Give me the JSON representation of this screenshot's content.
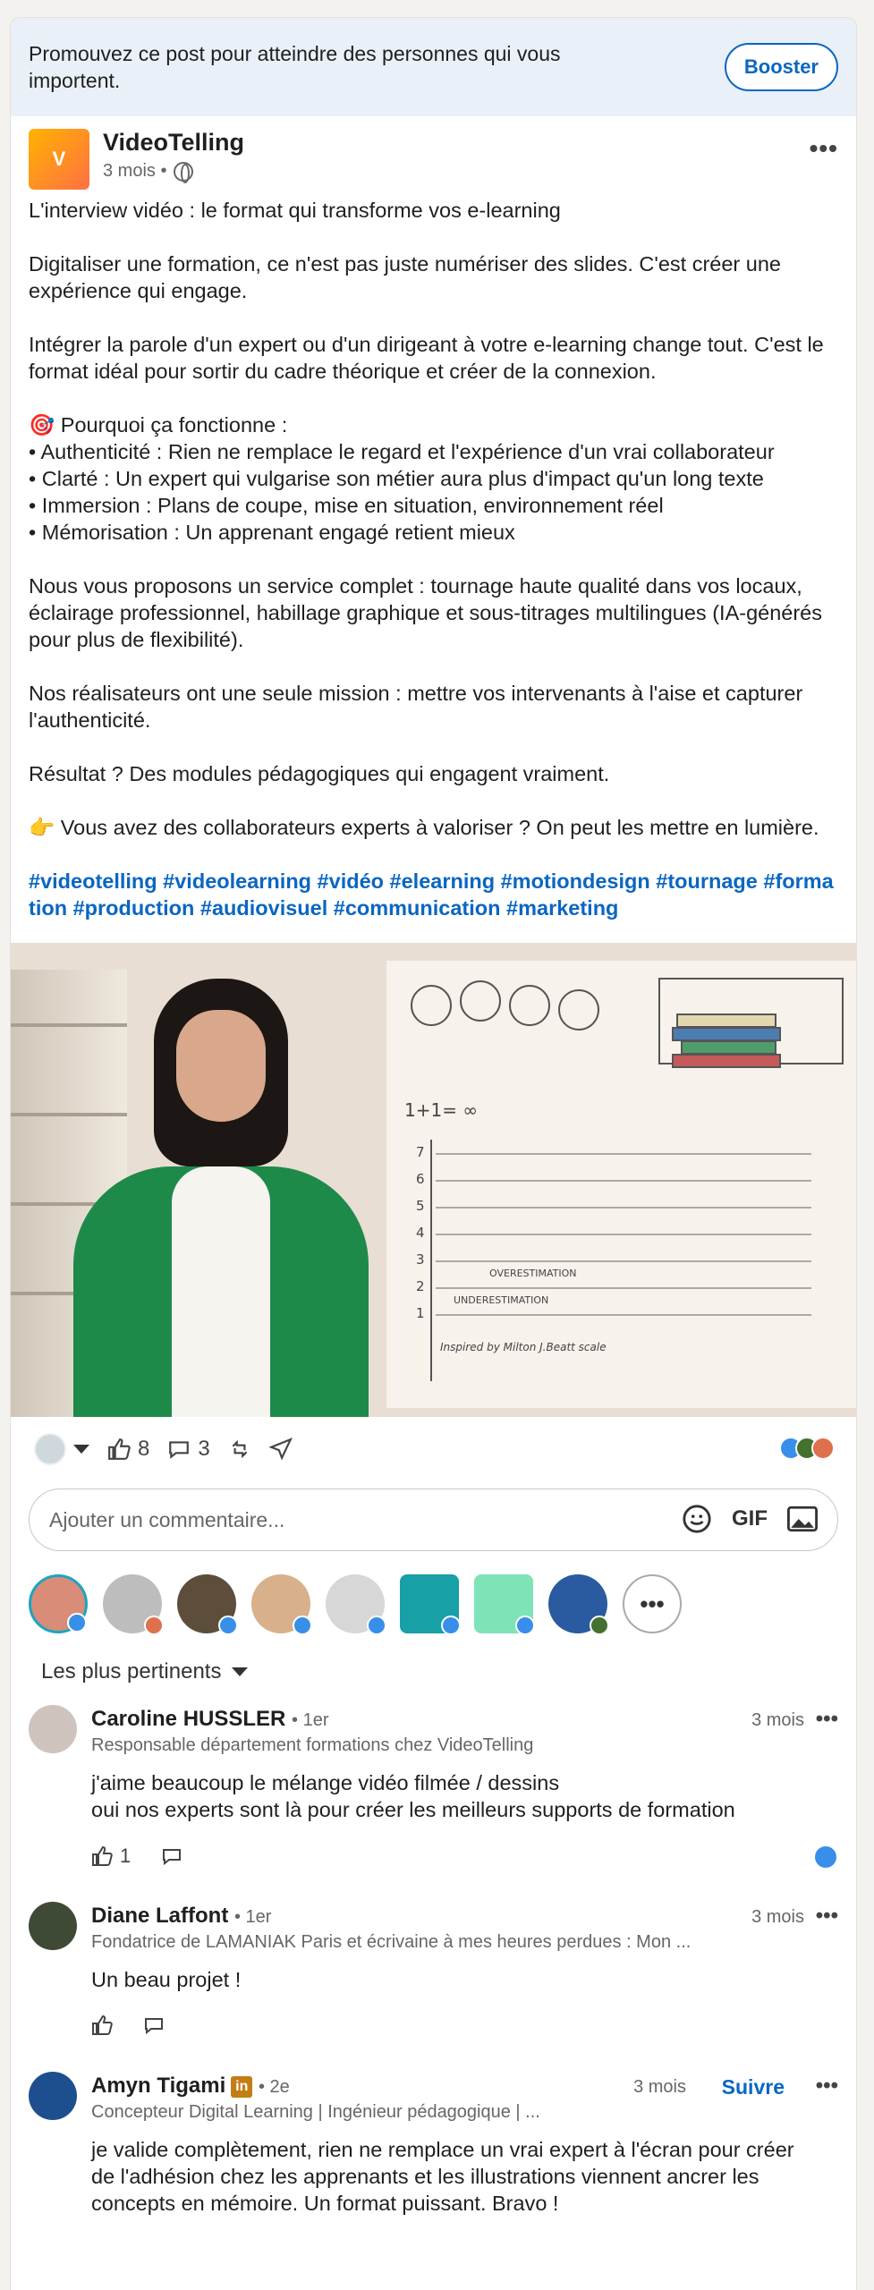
{
  "promo": {
    "text": "Promouvez ce post pour atteindre des personnes qui vous importent.",
    "boost_label": "Booster"
  },
  "post": {
    "logo_text": "V",
    "author": "VideoTelling",
    "age": "3 mois •",
    "paragraphs": [
      "L'interview vidéo : le format qui transforme vos e-learning",
      "Digitaliser une formation, ce n'est pas juste numériser des slides. C'est créer une expérience qui engage.",
      "Intégrer la parole d'un expert ou d'un dirigeant à votre e-learning change tout. C'est le format idéal pour sortir du cadre théorique et créer de la connexion.",
      "🎯 Pourquoi ça fonctionne :\n• Authenticité : Rien ne remplace le regard et l'expérience d'un vrai collaborateur\n• Clarté : Un expert qui vulgarise son métier aura plus d'impact qu'un long texte\n• Immersion : Plans de coupe, mise en situation, environnement réel\n• Mémorisation : Un apprenant engagé retient mieux",
      "Nous vous proposons un service complet : tournage haute qualité dans vos locaux, éclairage professionnel, habillage graphique et sous-titrages multilingues (IA-générés pour plus de flexibilité).",
      "Nos réalisateurs ont une seule mission : mettre vos intervenants à l'aise et capturer l'authenticité.",
      "Résultat ? Des modules pédagogiques qui engagent vraiment.",
      "👉 Vous avez des collaborateurs experts à valoriser ? On peut les mettre en lumière."
    ],
    "hashtags": "#videotelling #videolearning #vidéo #elearning #motiondesign #tournage #formation #production #audiovisuel #communication #marketing"
  },
  "media": {
    "equation": "1+1= ∞",
    "ticks": [
      "7",
      "6",
      "5",
      "4",
      "3",
      "2",
      "1"
    ],
    "label_over": "OVERESTIMATION",
    "label_under": "UNDERESTIMATION",
    "credit": "Inspired by Milton J.Beatt scale"
  },
  "actions": {
    "likes": "8",
    "comments": "3"
  },
  "comment_box": {
    "placeholder": "Ajouter un commentaire...",
    "gif": "GIF"
  },
  "sort_label": "Les plus pertinents",
  "comments": [
    {
      "name": "Caroline HUSSLER",
      "degree": "• 1er",
      "headline": "Responsable département formations chez VideoTelling",
      "time": "3 mois",
      "text": "j'aime beaucoup le mélange vidéo filmée / dessins\noui nos experts sont là pour créer les meilleurs supports de formation",
      "likes": "1"
    },
    {
      "name": "Diane Laffont",
      "degree": "• 1er",
      "headline": "Fondatrice de LAMANIAK Paris et écrivaine à mes heures perdues : Mon ...",
      "time": "3 mois",
      "text": "Un beau projet !"
    },
    {
      "name": "Amyn Tigami",
      "badge": "in",
      "degree": "• 2e",
      "headline": "Concepteur Digital Learning | Ingénieur pédagogique | ...",
      "time": "3 mois",
      "follow": "Suivre",
      "text": "je valide complètement, rien ne remplace un vrai expert à l'écran pour créer de l'adhésion chez les apprenants et les illustrations viennent ancrer les concepts en mémoire. Un format puissant. Bravo !"
    }
  ]
}
